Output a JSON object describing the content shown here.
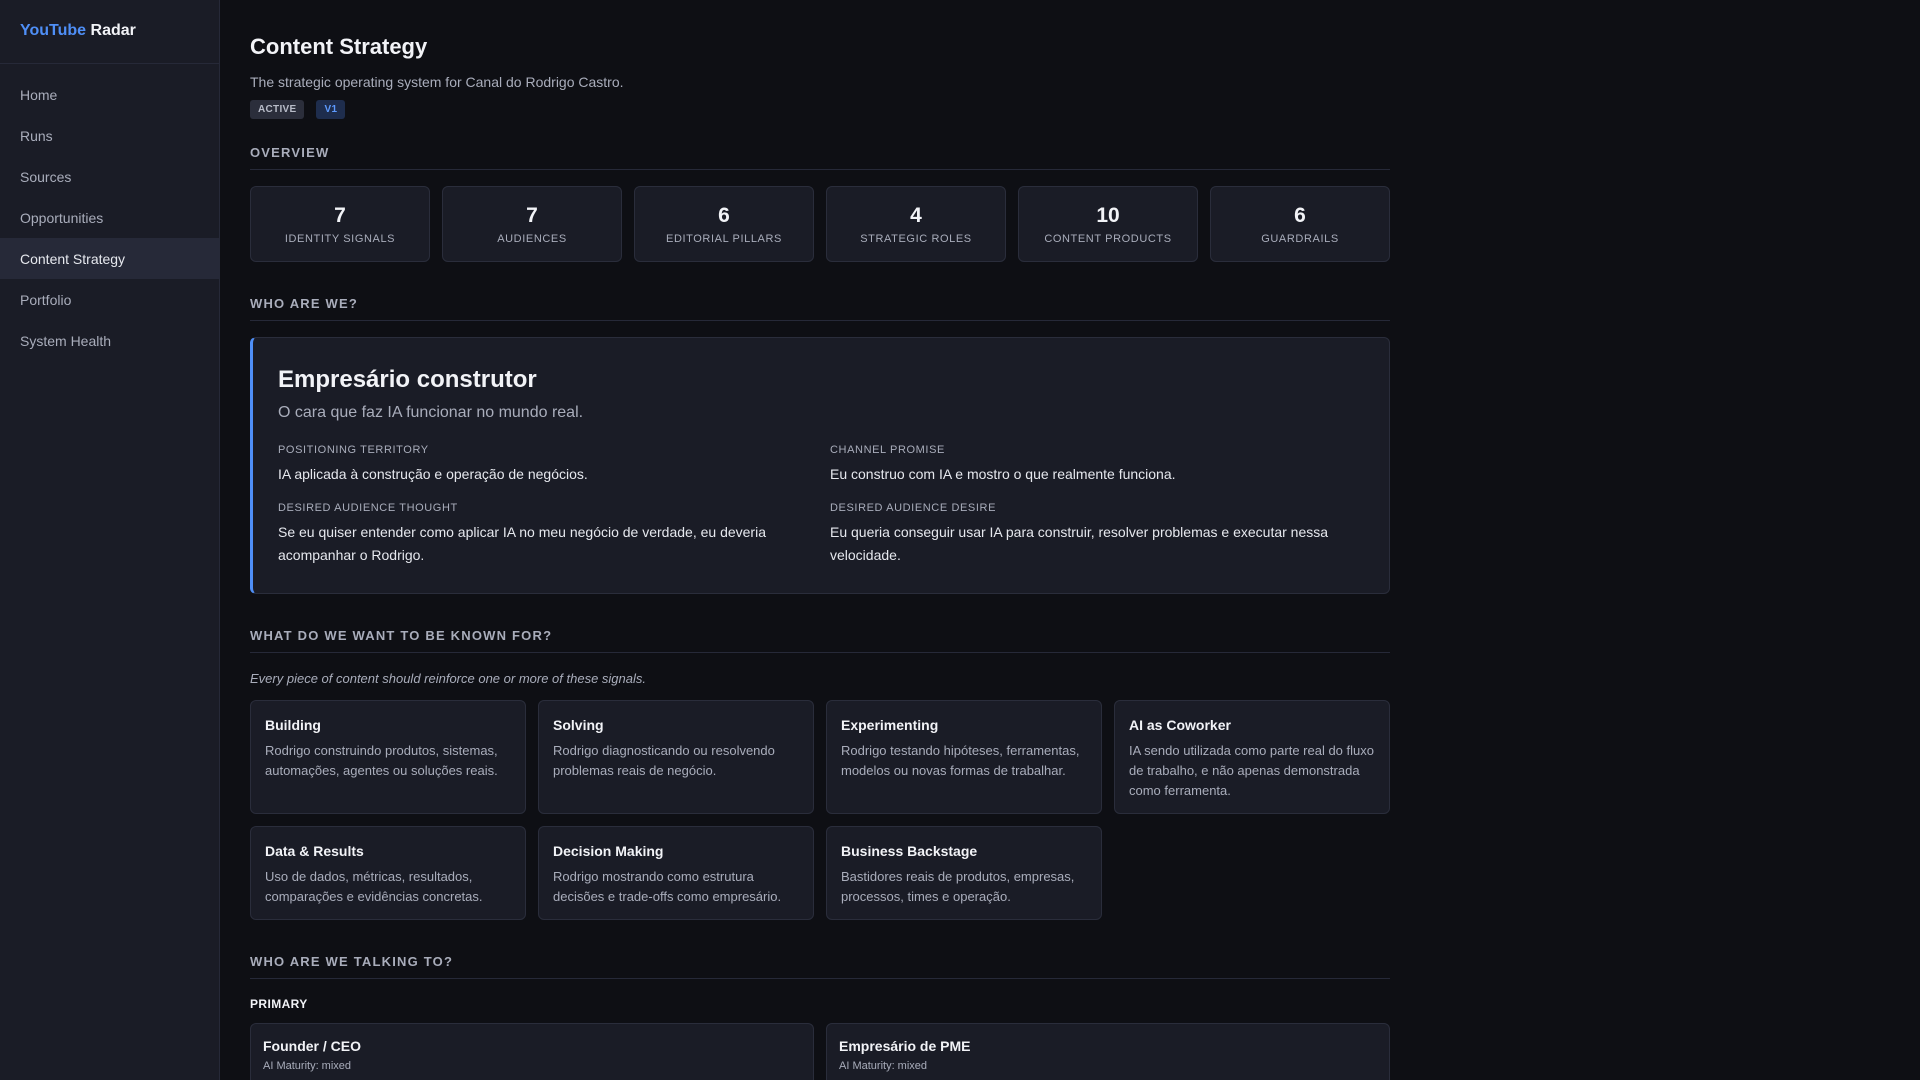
{
  "brand": {
    "part1": "YouTube",
    "part2": "Radar"
  },
  "nav": [
    {
      "label": "Home"
    },
    {
      "label": "Runs"
    },
    {
      "label": "Sources"
    },
    {
      "label": "Opportunities"
    },
    {
      "label": "Content Strategy",
      "active": true
    },
    {
      "label": "Portfolio"
    },
    {
      "label": "System Health"
    }
  ],
  "page": {
    "title": "Content Strategy",
    "subtitle": "The strategic operating system for Canal do Rodrigo Castro.",
    "status_badge": "ACTIVE",
    "version_badge": "V1"
  },
  "overview": {
    "heading": "OVERVIEW",
    "stats": [
      {
        "value": "7",
        "label": "IDENTITY SIGNALS"
      },
      {
        "value": "7",
        "label": "AUDIENCES"
      },
      {
        "value": "6",
        "label": "EDITORIAL PILLARS"
      },
      {
        "value": "4",
        "label": "STRATEGIC ROLES"
      },
      {
        "value": "10",
        "label": "CONTENT PRODUCTS"
      },
      {
        "value": "6",
        "label": "GUARDRAILS"
      }
    ]
  },
  "identity": {
    "heading": "WHO ARE WE?",
    "title": "Empresário construtor",
    "tagline": "O cara que faz IA funcionar no mundo real.",
    "positioning_label": "POSITIONING TERRITORY",
    "positioning": "IA aplicada à construção e operação de negócios.",
    "promise_label": "CHANNEL PROMISE",
    "promise": "Eu construo com IA e mostro o que realmente funciona.",
    "thought_label": "DESIRED AUDIENCE THOUGHT",
    "thought": "Se eu quiser entender como aplicar IA no meu negócio de verdade, eu deveria acompanhar o Rodrigo.",
    "desire_label": "DESIRED AUDIENCE DESIRE",
    "desire": "Eu queria conseguir usar IA para construir, resolver problemas e executar nessa velocidade."
  },
  "signals": {
    "heading": "WHAT DO WE WANT TO BE KNOWN FOR?",
    "note": "Every piece of content should reinforce one or more of these signals.",
    "items": [
      {
        "title": "Building",
        "desc": "Rodrigo construindo produtos, sistemas, automações, agentes ou soluções reais."
      },
      {
        "title": "Solving",
        "desc": "Rodrigo diagnosticando ou resolvendo problemas reais de negócio."
      },
      {
        "title": "Experimenting",
        "desc": "Rodrigo testando hipóteses, ferramentas, modelos ou novas formas de trabalhar."
      },
      {
        "title": "AI as Coworker",
        "desc": "IA sendo utilizada como parte real do fluxo de trabalho, e não apenas demonstrada como ferramenta."
      },
      {
        "title": "Data & Results",
        "desc": "Uso de dados, métricas, resultados, comparações e evidências concretas."
      },
      {
        "title": "Decision Making",
        "desc": "Rodrigo mostrando como estrutura decisões e trade-offs como empresário."
      },
      {
        "title": "Business Backstage",
        "desc": "Bastidores reais de produtos, empresas, processos, times e operação."
      }
    ]
  },
  "audiences": {
    "heading": "WHO ARE WE TALKING TO?",
    "primary_label": "PRIMARY",
    "items": [
      {
        "title": "Founder / CEO",
        "meta": "AI Maturity: mixed"
      },
      {
        "title": "Empresário de PME",
        "meta": "AI Maturity: mixed"
      }
    ]
  }
}
